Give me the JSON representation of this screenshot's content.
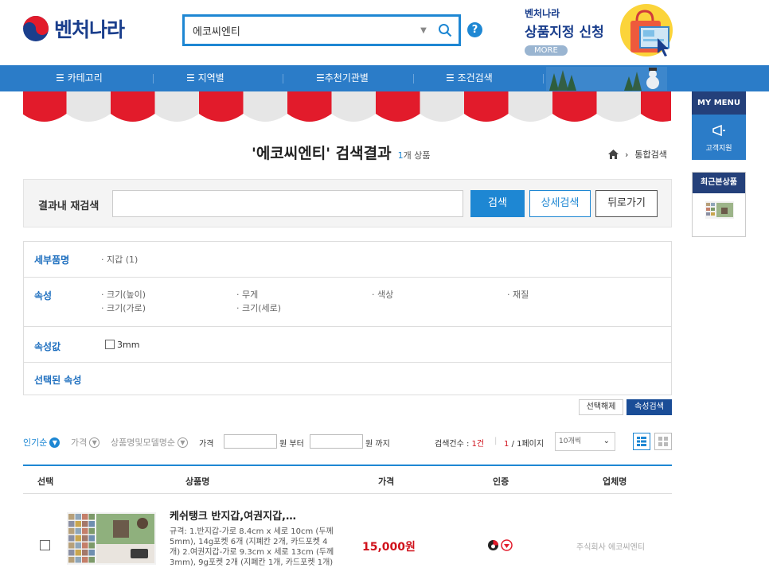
{
  "header": {
    "logo_text": "벤처나라",
    "search": {
      "value": "에코씨엔티"
    },
    "help_label": "?",
    "promo": {
      "sub": "벤처나라",
      "title": "상품지정 신청",
      "more": "MORE"
    }
  },
  "nav": {
    "items": [
      "☰ 카테고리",
      "☰ 지역별",
      "☰추천기관별",
      "☰ 조건검색"
    ]
  },
  "sidebar": {
    "mymenu": "MY MENU",
    "customer": "고객지원",
    "recent": "최근본상품"
  },
  "title": {
    "query_title": "'에코씨엔티' 검색결과",
    "count_num": "1",
    "count_suffix": "개 상품",
    "breadcrumb": "통합검색"
  },
  "research": {
    "label": "결과내 재검색",
    "search_btn": "검색",
    "detail_btn": "상세검색",
    "back_btn": "뒤로가기"
  },
  "filters": {
    "detail": {
      "label": "세부품명",
      "items": [
        "· 지갑 (1)"
      ]
    },
    "attrs": {
      "label": "속성",
      "items": [
        "· 크기(높이)",
        "· 무게",
        "· 색상",
        "· 재질",
        "· 크기(가로)",
        "· 크기(세로)"
      ]
    },
    "values": {
      "label": "속성값",
      "items": [
        "3mm"
      ]
    },
    "selected": {
      "label": "선택된 속성"
    },
    "unselect_btn": "선택해제",
    "attr_search_btn": "속성검색"
  },
  "sort": {
    "popular": "인기순",
    "price": "가격",
    "name": "상품명및모델명순",
    "price_label": "가격",
    "from": "원 부터",
    "to": "원 까지",
    "count_label": "검색건수 :",
    "count_value": "1건",
    "page_current": "1",
    "page_total": "/ 1페이지",
    "per_page": "10개씩"
  },
  "table": {
    "headers": [
      "선택",
      "상품명",
      "가격",
      "인증",
      "업체명"
    ],
    "rows": [
      {
        "name": "케쉬탱크 반지갑,여권지갑,…",
        "spec": "규격: 1.반지갑-가로 8.4cm x 세로 10cm (두께 5mm), 14g포켓 6개 (지폐칸 2개, 카드포켓 4개) 2.여권지갑-가로 9.3cm x 세로 13cm (두께 3mm), 9g포켓 2개 (지폐칸 1개, 카드포켓 1개)",
        "price": "15,000원",
        "vendor": "주식회사 에코씨엔티"
      }
    ]
  },
  "colors": {
    "accent": "#1e87d3",
    "nav": "#2b7cc8",
    "navy": "#24407a",
    "price": "#d0111b"
  }
}
